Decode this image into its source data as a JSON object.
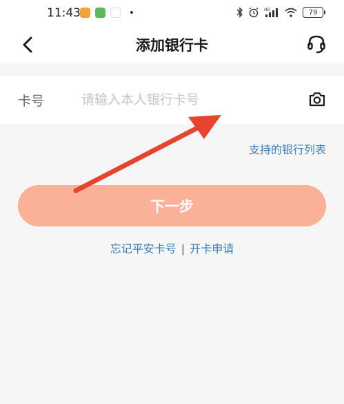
{
  "status_bar": {
    "time": "11:43",
    "battery": "79",
    "icons": [
      "app-icon-orange",
      "app-icon-green",
      "app-icon-58",
      "bluetooth-icon",
      "alarm-icon",
      "signal-icon",
      "wifi-icon",
      "battery-icon"
    ]
  },
  "navbar": {
    "title": "添加银行卡",
    "back_icon": "chevron-left-icon",
    "service_icon": "headset-icon"
  },
  "card_row": {
    "label": "卡号",
    "placeholder": "请输入本人银行卡号",
    "camera_icon": "camera-icon"
  },
  "bank_list_link": "支持的银行列表",
  "next_button": "下一步",
  "footer": {
    "forgot_link": "忘记平安卡号",
    "separator": "|",
    "apply_link": "开卡申请"
  },
  "colors": {
    "accent_button": "#fbb197",
    "link": "#3a7db8",
    "annotation_arrow": "#e8432c",
    "background": "#f6f6f6"
  }
}
